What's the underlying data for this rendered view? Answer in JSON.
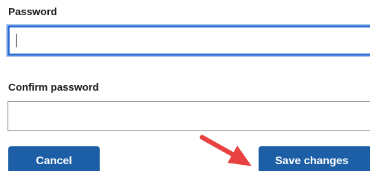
{
  "form": {
    "password_label": "Password",
    "password_value": "",
    "confirm_label": "Confirm password",
    "confirm_value": ""
  },
  "actions": {
    "cancel_label": "Cancel",
    "save_label": "Save changes"
  },
  "colors": {
    "button_bg": "#1d5fa6",
    "focus_border": "#2b6cd4",
    "annotation_arrow": "#e8413f"
  },
  "icons": {
    "annotation": "red-arrow-icon"
  }
}
